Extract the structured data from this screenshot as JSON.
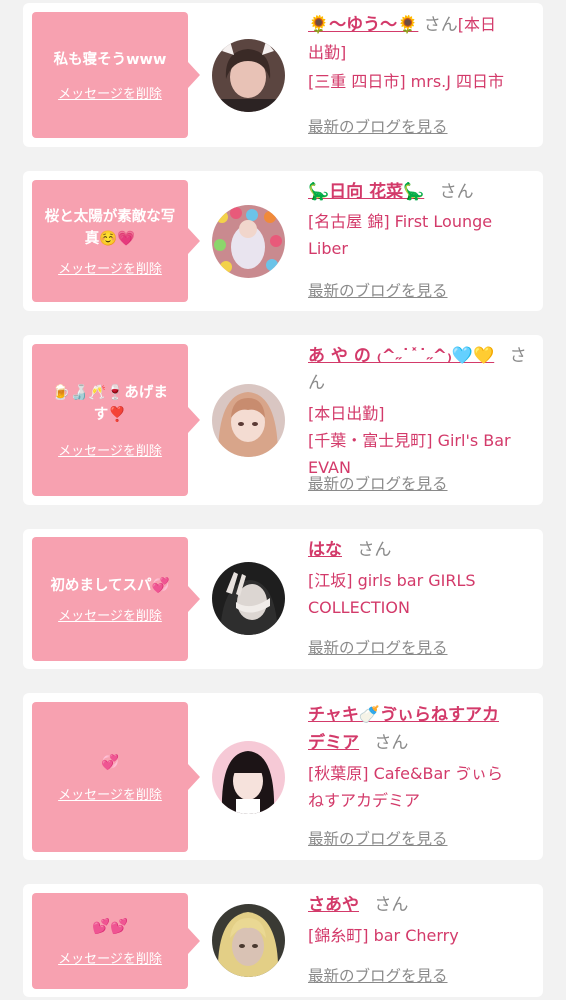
{
  "common": {
    "san": "さん",
    "delete_label": "メッセージを削除",
    "blog_label": "最新のブログを見る"
  },
  "colors": {
    "background": "#f2f2f2",
    "bubble": "#f7a1b0",
    "name": "#d33a6a",
    "gray": "#8a8a8a"
  },
  "cards": [
    {
      "message": "私も寝そうwww",
      "name": "🌻〜ゆう〜🌻",
      "shop_lines": [
        "[本日",
        "出勤]",
        "[三重 四日市] mrs.J 四日市"
      ]
    },
    {
      "message": "桜と太陽が素敵な写真☺️💗",
      "name": "🦕日向 花菜🦕",
      "shop_lines": [
        "[名古屋 錦] First Lounge",
        "Liber"
      ]
    },
    {
      "message": "🍺🍶🥂🍷あげます❣️",
      "name": "あ や の ₍^˶˙˟˙˶^₎🩵💛",
      "shop_lines": [
        "[本日出勤]",
        "[千葉・富士見町] Girl's Bar",
        "EVAN"
      ]
    },
    {
      "message": "初めましてスパ💞",
      "name": "はな",
      "shop_lines": [
        "[江坂] girls bar GIRLS",
        "COLLECTION"
      ]
    },
    {
      "message": "💞",
      "name_lines": [
        "チャキ🍼ゔぃらねすアカ",
        "デミア"
      ],
      "shop_lines": [
        "[秋葉原] Cafe&Bar ゔぃら",
        "ねすアカデミア"
      ]
    },
    {
      "message": "💕💕",
      "name": "さあや",
      "shop_lines": [
        "[錦糸町] bar Cherry"
      ]
    }
  ]
}
